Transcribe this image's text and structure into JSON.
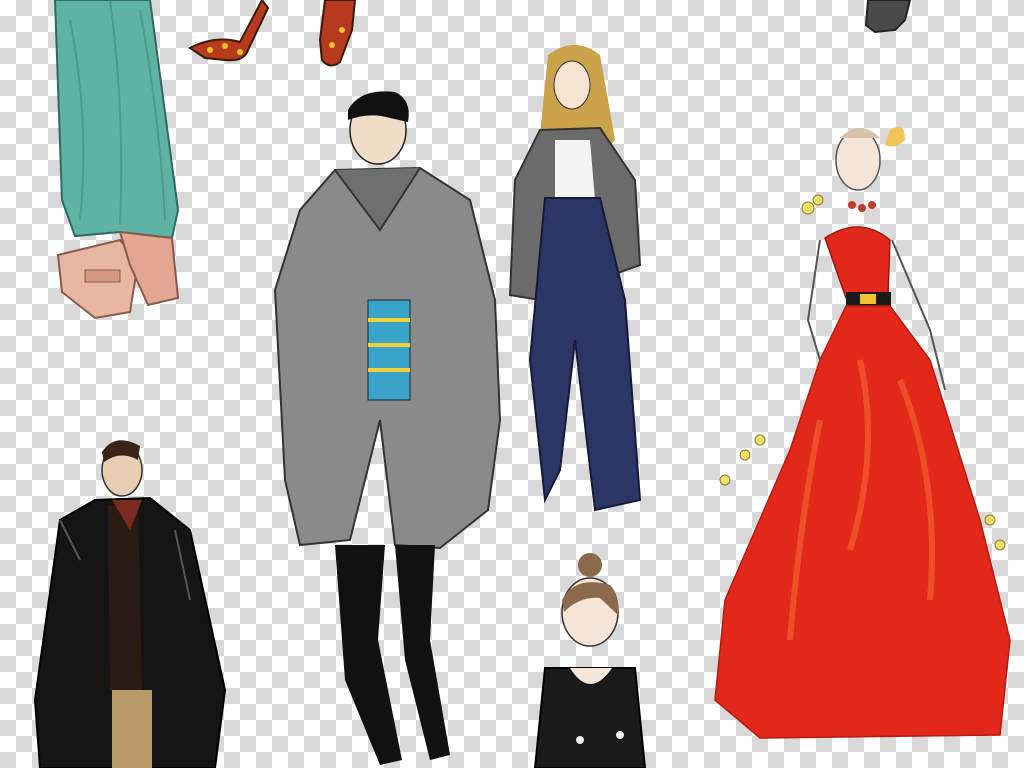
{
  "canvas": {
    "background": "transparency-checkerboard",
    "checker_light": "#ffffff",
    "checker_dark": "#d9d9d9"
  },
  "illustrations": [
    {
      "id": "teal-skirt-sandals",
      "colors": [
        "#5fb3a5",
        "#e8b7a4"
      ]
    },
    {
      "id": "leopard-heels",
      "colors": [
        "#b83a1e",
        "#f2c230"
      ]
    },
    {
      "id": "grey-coat-man",
      "colors": [
        "#8a8a8a",
        "#1a1a1a",
        "#3aa3c9"
      ]
    },
    {
      "id": "blonde-woman-wide-jeans",
      "colors": [
        "#6b6b6b",
        "#2b3566",
        "#c9a24a"
      ]
    },
    {
      "id": "red-gown-woman",
      "colors": [
        "#e2281b",
        "#f05a2a",
        "#f0e06a"
      ]
    },
    {
      "id": "black-leather-coat-man",
      "colors": [
        "#141414",
        "#7a2a1f",
        "#b89a6a"
      ]
    },
    {
      "id": "bun-hair-girl-black-top",
      "colors": [
        "#1a1a1a",
        "#8a6a4a"
      ]
    },
    {
      "id": "grey-boot-fragment",
      "colors": [
        "#4a4a4a"
      ]
    }
  ]
}
